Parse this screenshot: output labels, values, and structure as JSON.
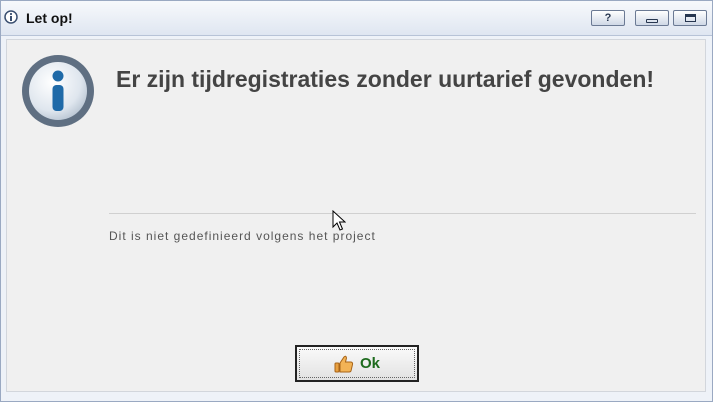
{
  "window": {
    "title": "Let op!",
    "title_icon": "info-icon",
    "help_label": "?",
    "controls": [
      "minimize-icon",
      "maximize-icon"
    ]
  },
  "dialog": {
    "icon": "info-icon",
    "heading": "Er zijn tijdregistraties zonder uurtarief gevonden!",
    "description": "Dit is niet gedefinieerd volgens het project"
  },
  "buttons": {
    "ok_label": "Ok",
    "ok_icon": "thumbs-up-icon"
  },
  "colors": {
    "ok_text": "#1e6b1e",
    "heading_text": "#444444",
    "titlebar_bg": "#dfe6f1"
  }
}
